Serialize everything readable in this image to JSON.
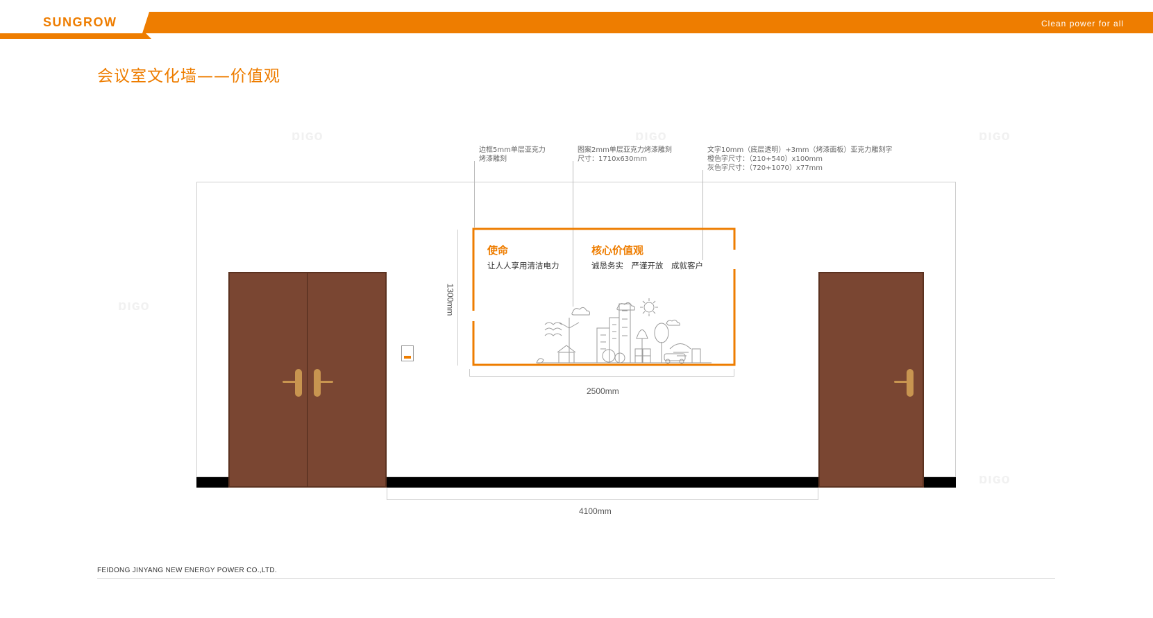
{
  "header": {
    "brand": "SUNGROW",
    "tagline": "Clean  power  for  all",
    "accent_color": "#ee7d00"
  },
  "page_title": "会议室文化墙——价值观",
  "annotations": {
    "frame_spec": [
      "边框5mm单层亚克力",
      "烤漆雕刻"
    ],
    "pattern_spec": [
      "图案2mm单层亚克力烤漆雕刻",
      "尺寸：1710x630mm"
    ],
    "text_spec": [
      "文字10mm（底层透明）+3mm（烤漆面板）亚克力雕刻字",
      "橙色字尺寸：（210+540）x100mm",
      "灰色字尺寸：（720+1070）x77mm"
    ]
  },
  "dimensions": {
    "panel_height": "1300mm",
    "panel_width": "2500mm",
    "wall_width": "4100mm"
  },
  "panel": {
    "mission_title": "使命",
    "mission_text": "让人人享用清洁电力",
    "values_title": "核心价值观",
    "values_text": "诚恳务实　严谨开放　成就客户"
  },
  "footer": {
    "company": "FEIDONG JINYANG NEW ENERGY POWER CO.,LTD."
  },
  "colors": {
    "door": "#7a4632",
    "handle": "#c89550",
    "floor": "#000000"
  },
  "icons": [
    "city-skyline-illustration",
    "door-handle-icon",
    "light-switch-icon"
  ]
}
